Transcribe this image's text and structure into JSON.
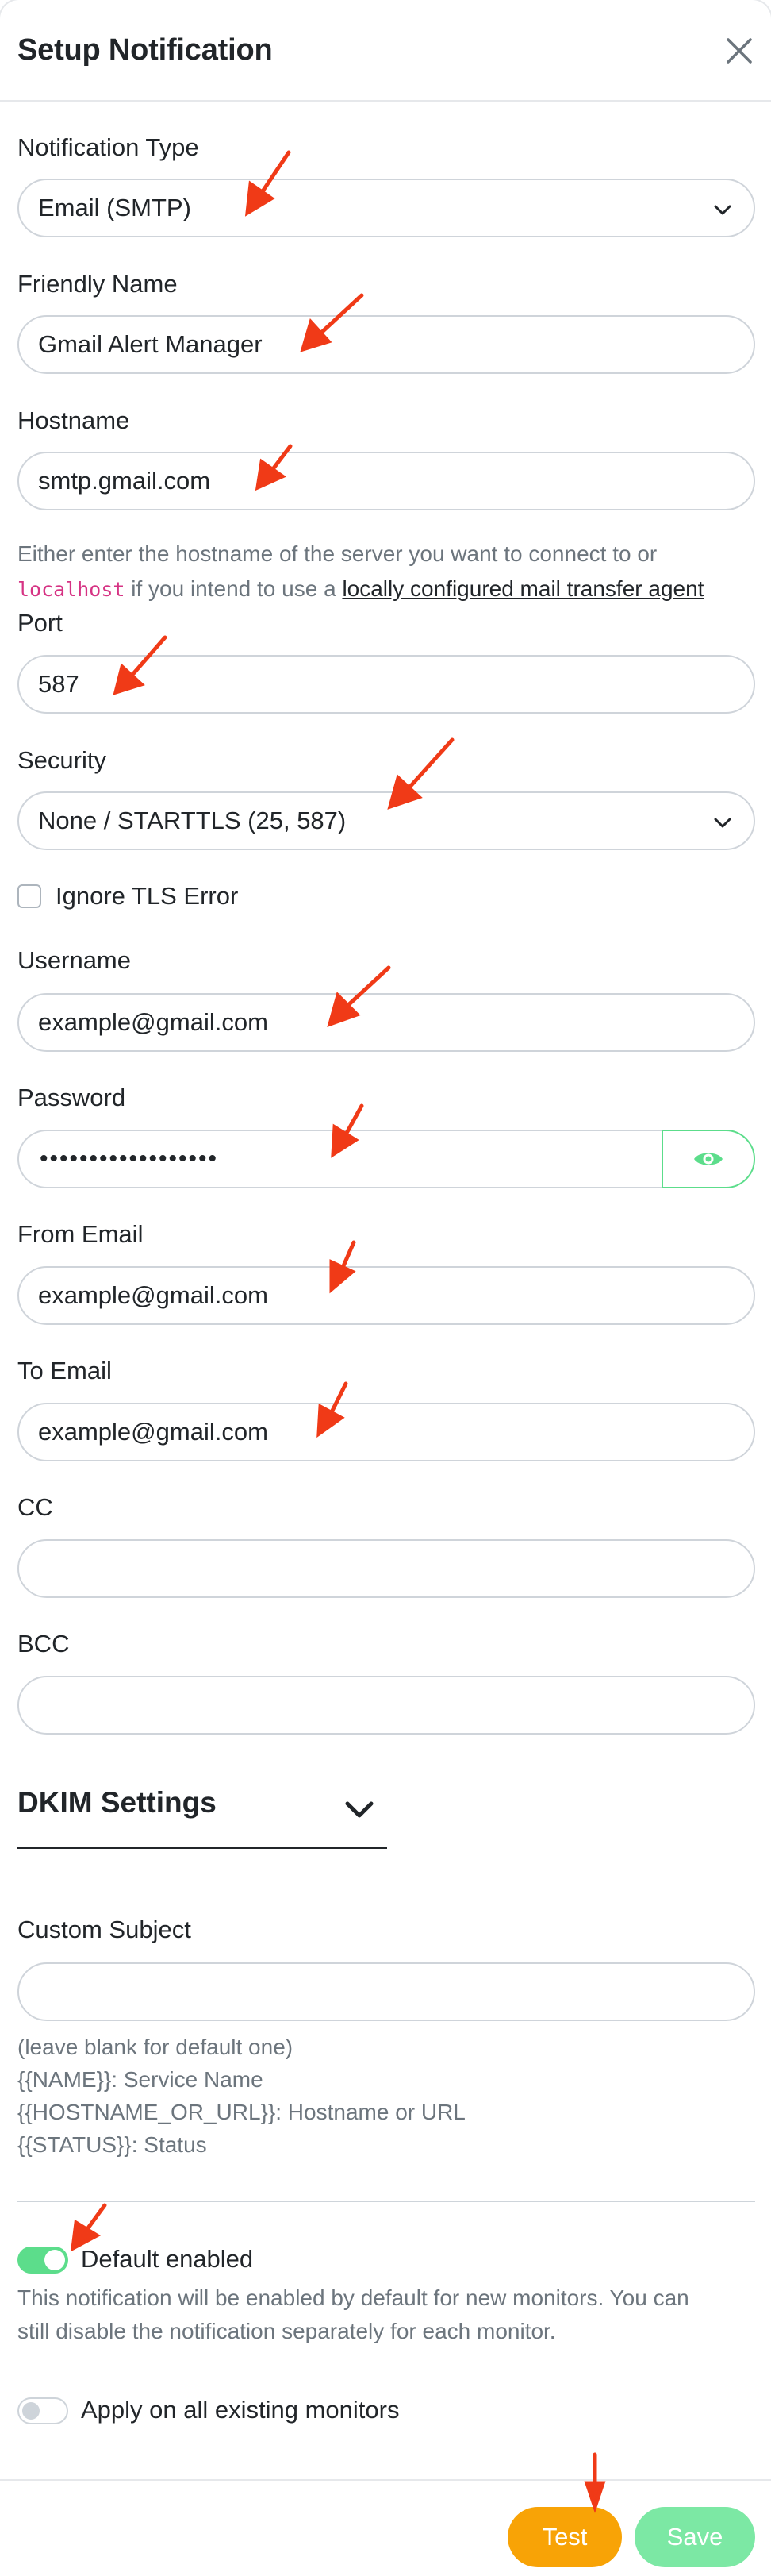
{
  "modal": {
    "title": "Setup Notification"
  },
  "form": {
    "notification_type": {
      "label": "Notification Type",
      "value": "Email (SMTP)"
    },
    "friendly_name": {
      "label": "Friendly Name",
      "value": "Gmail Alert Manager"
    },
    "hostname": {
      "label": "Hostname",
      "value": "smtp.gmail.com",
      "help_prefix": "Either enter the hostname of the server you want to connect to or",
      "help_code": "localhost",
      "help_middle": " if you intend to use a ",
      "help_link": "locally configured mail transfer agent"
    },
    "port": {
      "label": "Port",
      "value": "587"
    },
    "security": {
      "label": "Security",
      "value": "None / STARTTLS (25, 587)"
    },
    "ignore_tls": {
      "label": "Ignore TLS Error",
      "checked": false
    },
    "username": {
      "label": "Username",
      "value": "example@gmail.com"
    },
    "password": {
      "label": "Password",
      "value": "••••••••••••••••••"
    },
    "from_email": {
      "label": "From Email",
      "value": "example@gmail.com"
    },
    "to_email": {
      "label": "To Email",
      "value": "example@gmail.com"
    },
    "cc": {
      "label": "CC",
      "value": ""
    },
    "bcc": {
      "label": "BCC",
      "value": ""
    },
    "dkim": {
      "title": "DKIM Settings"
    },
    "custom_subject": {
      "label": "Custom Subject",
      "value": "",
      "help": [
        "(leave blank for default one)",
        "{{NAME}}: Service Name",
        "{{HOSTNAME_OR_URL}}: Hostname or URL",
        "{{STATUS}}: Status"
      ]
    },
    "default_enabled": {
      "label": "Default enabled",
      "on": true,
      "help_line1": "This notification will be enabled by default for new monitors. You can",
      "help_line2": "still disable the notification separately for each monitor."
    },
    "apply_existing": {
      "label": "Apply on all existing monitors",
      "on": false
    }
  },
  "footer": {
    "test_label": "Test",
    "save_label": "Save"
  },
  "colors": {
    "accent_green": "#5cdd8b",
    "test_orange": "#f8a306",
    "save_green": "#7ce8a4",
    "annotation_arrow": "#f03a17",
    "code_pink": "#d63384"
  },
  "icons": {
    "close": "close-icon",
    "dropdown": "chevron-down-icon",
    "show_password": "eye-icon",
    "annotation": "arrow-annotation-icon"
  }
}
